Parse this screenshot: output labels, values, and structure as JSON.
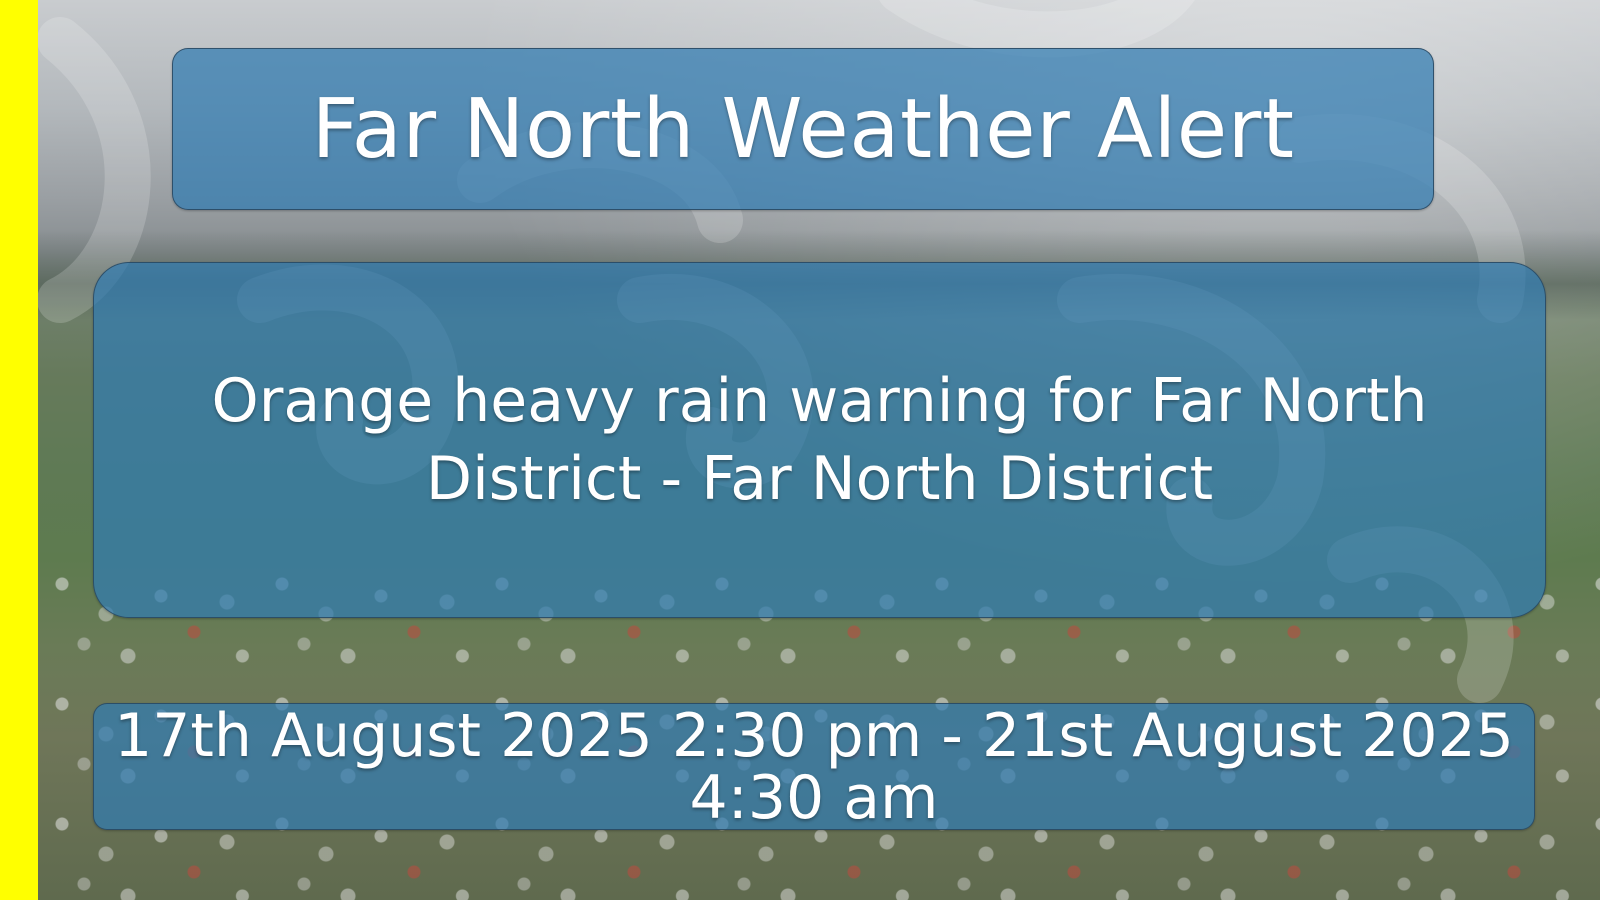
{
  "title": "Far North Weather Alert",
  "warning": "Orange heavy rain warning for Far North District - Far North District",
  "period": "17th August 2025 2:30 pm - 21st August 2025 4:30 am",
  "colors": {
    "accent_bar": "#ffff00",
    "panel_blue": "#307cb2",
    "text": "#ffffff"
  }
}
